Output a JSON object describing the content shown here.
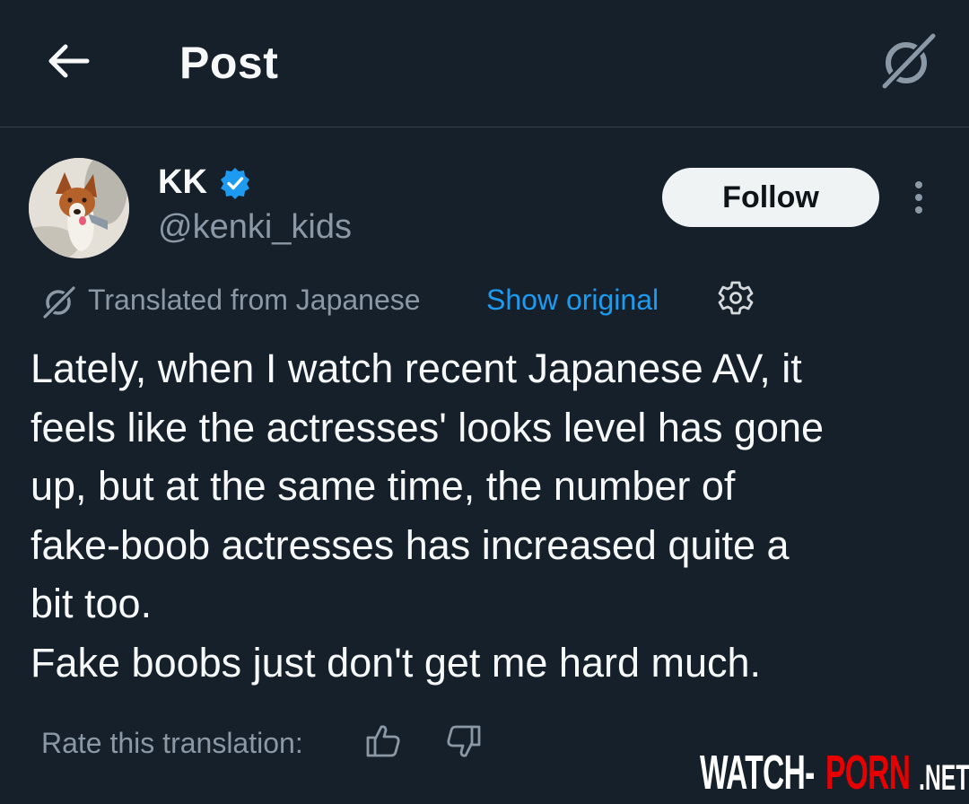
{
  "header": {
    "title": "Post",
    "back_icon": "arrow-left-icon",
    "grok_icon": "grok-icon"
  },
  "author": {
    "display_name": "KK",
    "handle": "@kenki_kids",
    "verified": true,
    "verified_color": "#1d9bf0"
  },
  "actions": {
    "follow_label": "Follow",
    "more_icon": "more-vertical-icon"
  },
  "translation": {
    "translated_from": "Translated from Japanese",
    "show_original": "Show original",
    "settings_icon": "gear-icon"
  },
  "post": {
    "lines": [
      "Lately, when I watch recent Japanese AV, it",
      "feels like the actresses' looks level has gone",
      "up, but at the same time, the number of",
      "fake-boob actresses has increased quite a",
      "bit too.",
      "Fake boobs just don't get me hard much."
    ]
  },
  "rating": {
    "label": "Rate this translation:",
    "thumbs_up_icon": "thumbs-up-icon",
    "thumbs_down_icon": "thumbs-down-icon"
  },
  "watermark": {
    "part1": "WATCH-",
    "part2": "PORN",
    "part3": ".NET"
  },
  "colors": {
    "background": "#15202b",
    "text_primary": "#f7f9f9",
    "text_secondary": "#8b98a5",
    "link": "#1d9bf0",
    "follow_bg": "#eff3f4",
    "watermark_red": "#e60000"
  }
}
